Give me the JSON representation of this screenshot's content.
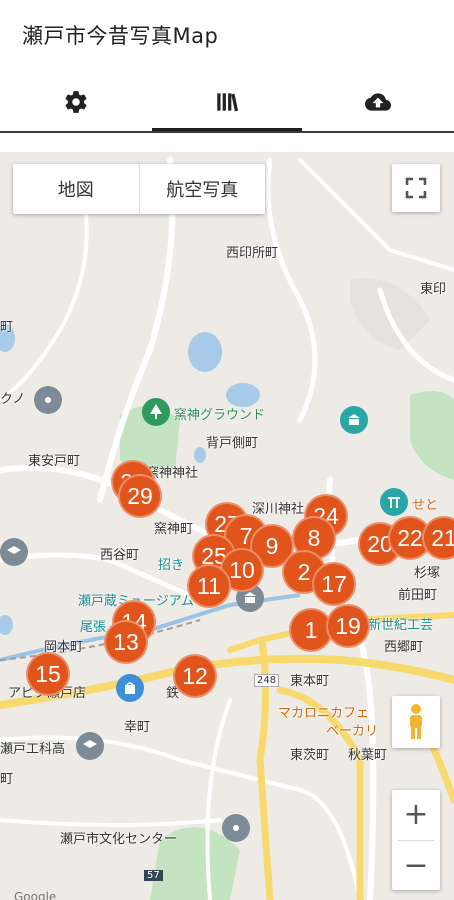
{
  "app": {
    "title": "瀬戸市今昔写真Map"
  },
  "tabs": [
    {
      "id": "settings",
      "icon": "gear-icon"
    },
    {
      "id": "library",
      "icon": "library-icon"
    },
    {
      "id": "upload",
      "icon": "cloud-upload-icon"
    }
  ],
  "selected_tab": "library",
  "map_type": {
    "map_label": "地図",
    "satellite_label": "航空写真"
  },
  "zoom": {
    "in": "+",
    "out": "−"
  },
  "place_labels": {
    "nishi_insho": "西印所町",
    "higashi_in": "東印",
    "kamagami_ground": "窯神グラウンド",
    "sedogawa": "背戸側町",
    "higashi_anto": "東安戸町",
    "kamagami_shrine": "窯神神社",
    "kamagami_cho": "窯神町",
    "fukagawa_shrine": "深川神社",
    "nishitani": "西谷町",
    "maneki": "招き",
    "seto_museum": "瀬戸蔵ミュージアム",
    "owari": "尾張",
    "okamoto": "岡本町",
    "apita": "アピタ瀬戸店",
    "sugiwaki": "杉塚",
    "maeda": "前田町",
    "shinseiki": "新世紀工芸",
    "nishigo": "西郷町",
    "higashi_hon": "東本町",
    "macaroni": "マカロニカフェ",
    "bakery": "ベーカリ",
    "kurokane": "鉄",
    "saiwai": "幸町",
    "seto_kogyo": "瀬戸工科高",
    "higashi_mosu": "東茨町",
    "akiba": "秋葉町",
    "bunka_center": "瀬戸市文化センター",
    "route_248": "248",
    "route_57": "57",
    "google": "Google",
    "frag_kuno": "クノ",
    "frag_cho": "町",
    "frag_seto": "せと"
  },
  "markers": [
    "29",
    "27",
    "24",
    "25",
    "7",
    "9",
    "8",
    "20",
    "22",
    "21",
    "10",
    "11",
    "2",
    "17",
    "14",
    "13",
    "1",
    "19",
    "15",
    "12"
  ]
}
